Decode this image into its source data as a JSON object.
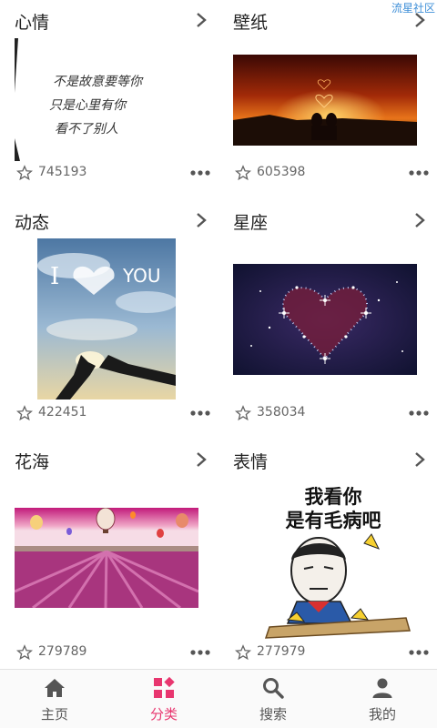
{
  "watermark": "流星社区",
  "categories": [
    {
      "title": "心情",
      "count": "745193"
    },
    {
      "title": "壁纸",
      "count": "605398"
    },
    {
      "title": "动态",
      "count": "422451"
    },
    {
      "title": "星座",
      "count": "358034"
    },
    {
      "title": "花海",
      "count": "279789"
    },
    {
      "title": "表情",
      "count": "277979"
    }
  ],
  "thumb_text": {
    "mood": [
      "不是故意要等你",
      "只是心里有你",
      "看不了别人"
    ],
    "love": "I",
    "you": "YOU",
    "meme": [
      "我看你",
      "是有毛病吧"
    ]
  },
  "tabs": [
    {
      "label": "主页",
      "icon": "home-icon"
    },
    {
      "label": "分类",
      "icon": "category-icon"
    },
    {
      "label": "搜索",
      "icon": "search-icon"
    },
    {
      "label": "我的",
      "icon": "profile-icon"
    }
  ],
  "colors": {
    "accent": "#e8366f",
    "tab_inactive": "#555555",
    "watermark": "#3f8fd8"
  }
}
